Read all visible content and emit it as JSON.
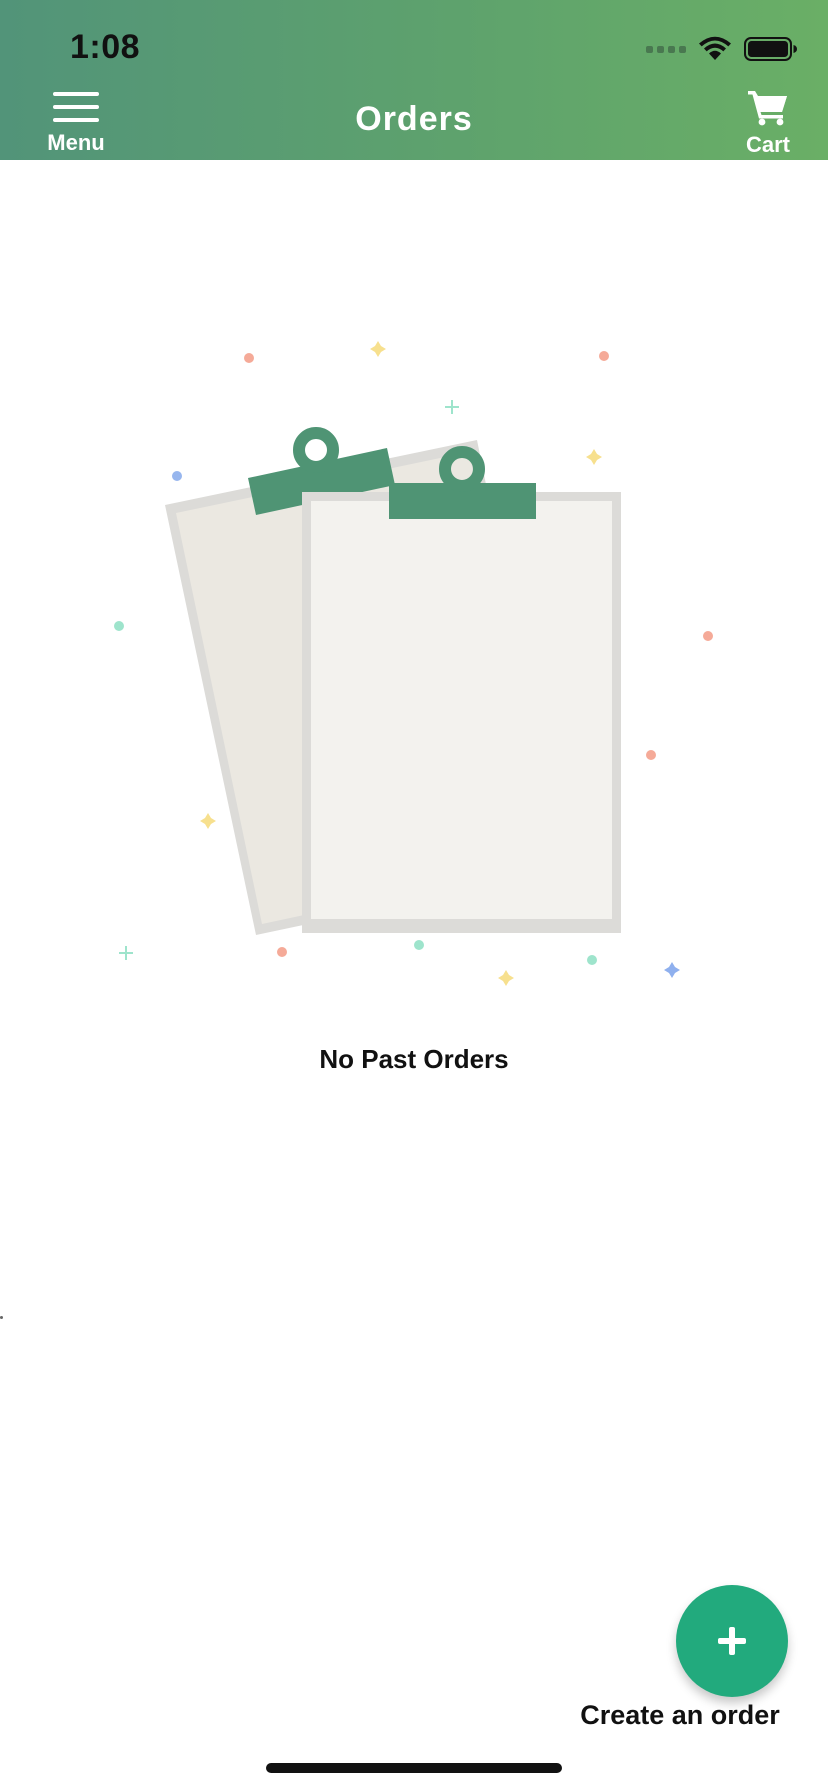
{
  "status_bar": {
    "time": "1:08"
  },
  "header": {
    "title": "Orders",
    "menu_label": "Menu",
    "cart_label": "Cart"
  },
  "empty_state": {
    "message": "No Past Orders"
  },
  "fab": {
    "label": "Create an order",
    "icon": "plus-icon"
  },
  "colors": {
    "header_gradient_start": "#529479",
    "header_gradient_end": "#6aaf66",
    "accent": "#22aa7d",
    "clipboard_clip": "#4f9474",
    "paper_back": "#ebe8e1",
    "paper_front": "#f3f2ee"
  },
  "icons": {
    "menu": "hamburger-menu-icon",
    "cart": "shopping-cart-icon",
    "wifi": "wifi-icon",
    "battery": "battery-icon",
    "signal": "cellular-signal-icon",
    "illustration": "clipboards-illustration"
  }
}
